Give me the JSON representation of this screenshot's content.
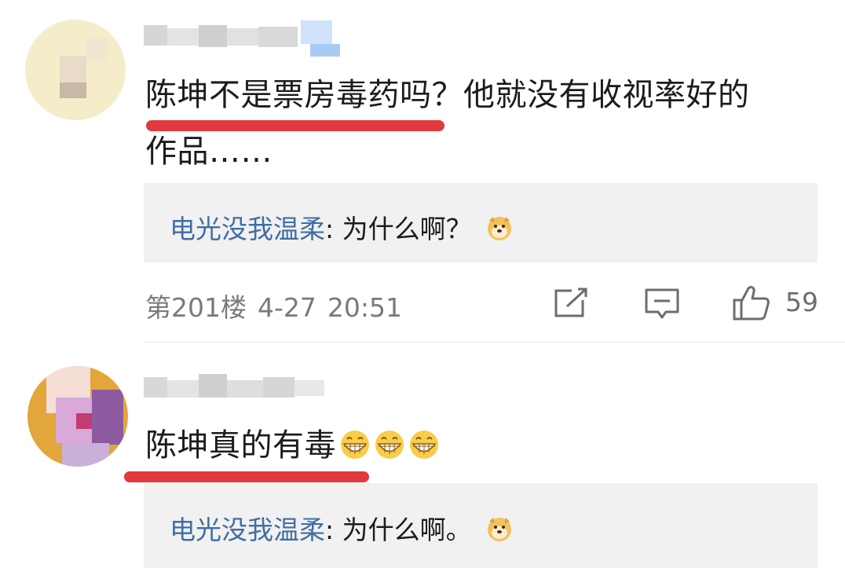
{
  "comments": [
    {
      "text_line1": "陈坤不是票房毒药吗？他就没有收视率好的",
      "text_line2": "作品……",
      "reply": {
        "user": "电光没我温柔",
        "separator": ":",
        "message": "为什么啊？",
        "emoji": "doge-icon"
      },
      "floor_meta": {
        "floor": "第201楼",
        "date": "4-27",
        "time": "20:51"
      },
      "likes": "59"
    },
    {
      "text": "陈坤真的有毒",
      "emojis": [
        "grin-icon",
        "grin-icon",
        "grin-icon"
      ],
      "reply": {
        "user": "电光没我温柔",
        "separator": ":",
        "message": "为什么啊。",
        "emoji": "doge-icon"
      }
    }
  ],
  "colors": {
    "highlight_underline": "#e0393f",
    "reply_user": "#3f6ea3",
    "reply_bg": "#f1f1f1",
    "meta_text": "#7a7a7a"
  }
}
